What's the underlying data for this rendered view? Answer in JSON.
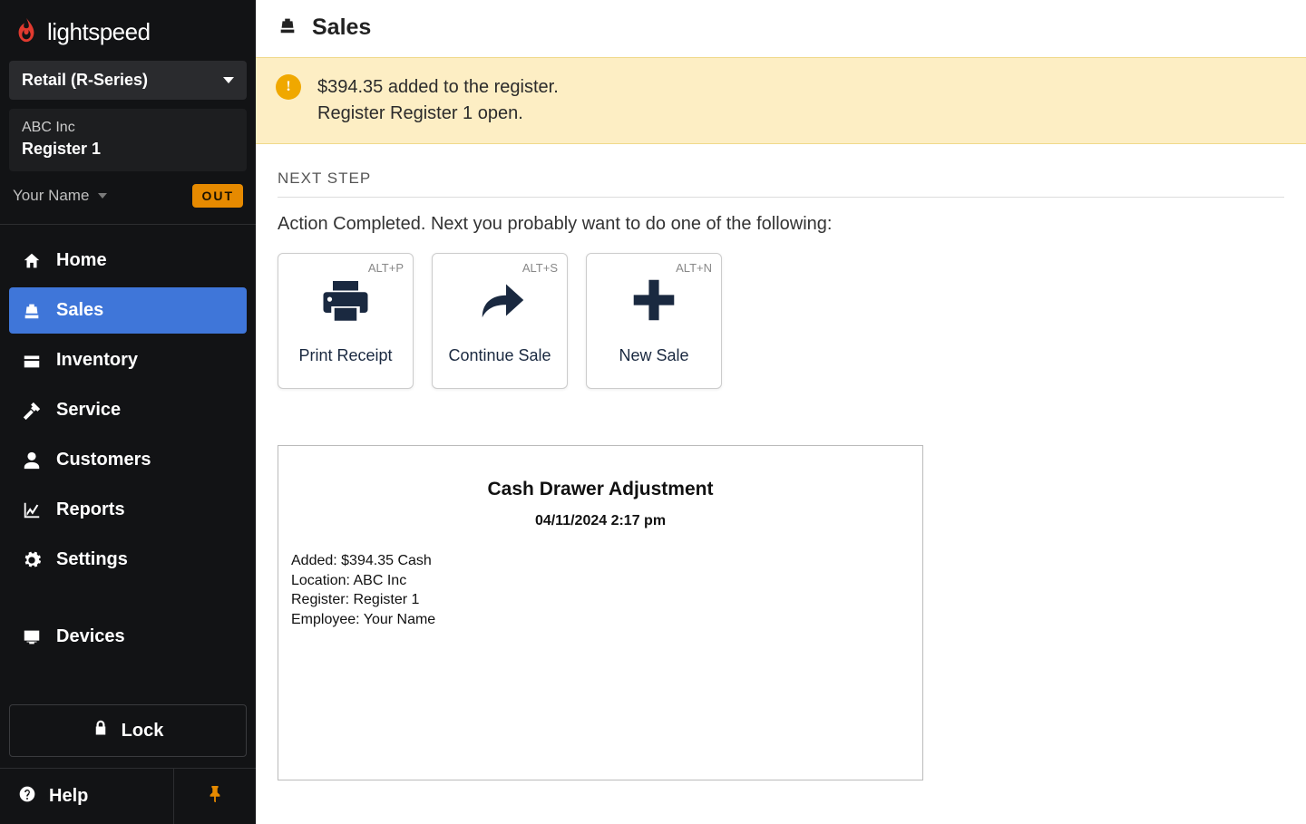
{
  "brand": {
    "name": "lightspeed"
  },
  "sidebar": {
    "series_label": "Retail (R-Series)",
    "company": "ABC Inc",
    "register": "Register 1",
    "user": "Your Name",
    "out_label": "OUT",
    "nav": [
      {
        "label": "Home"
      },
      {
        "label": "Sales"
      },
      {
        "label": "Inventory"
      },
      {
        "label": "Service"
      },
      {
        "label": "Customers"
      },
      {
        "label": "Reports"
      },
      {
        "label": "Settings"
      },
      {
        "label": "Devices"
      }
    ],
    "lock_label": "Lock",
    "help_label": "Help"
  },
  "page": {
    "title": "Sales",
    "banner_line1": "$394.35 added to the register.",
    "banner_line2": "Register Register 1 open.",
    "section_heading": "NEXT STEP",
    "prompt": "Action Completed. Next you probably want to do one of the following:",
    "cards": [
      {
        "shortcut": "ALT+P",
        "label": "Print Receipt"
      },
      {
        "shortcut": "ALT+S",
        "label": "Continue Sale"
      },
      {
        "shortcut": "ALT+N",
        "label": "New Sale"
      }
    ],
    "receipt": {
      "title": "Cash Drawer Adjustment",
      "timestamp": "04/11/2024 2:17 pm",
      "lines": [
        "Added: $394.35 Cash",
        "Location: ABC Inc",
        "Register: Register 1",
        "Employee: Your Name"
      ]
    }
  }
}
